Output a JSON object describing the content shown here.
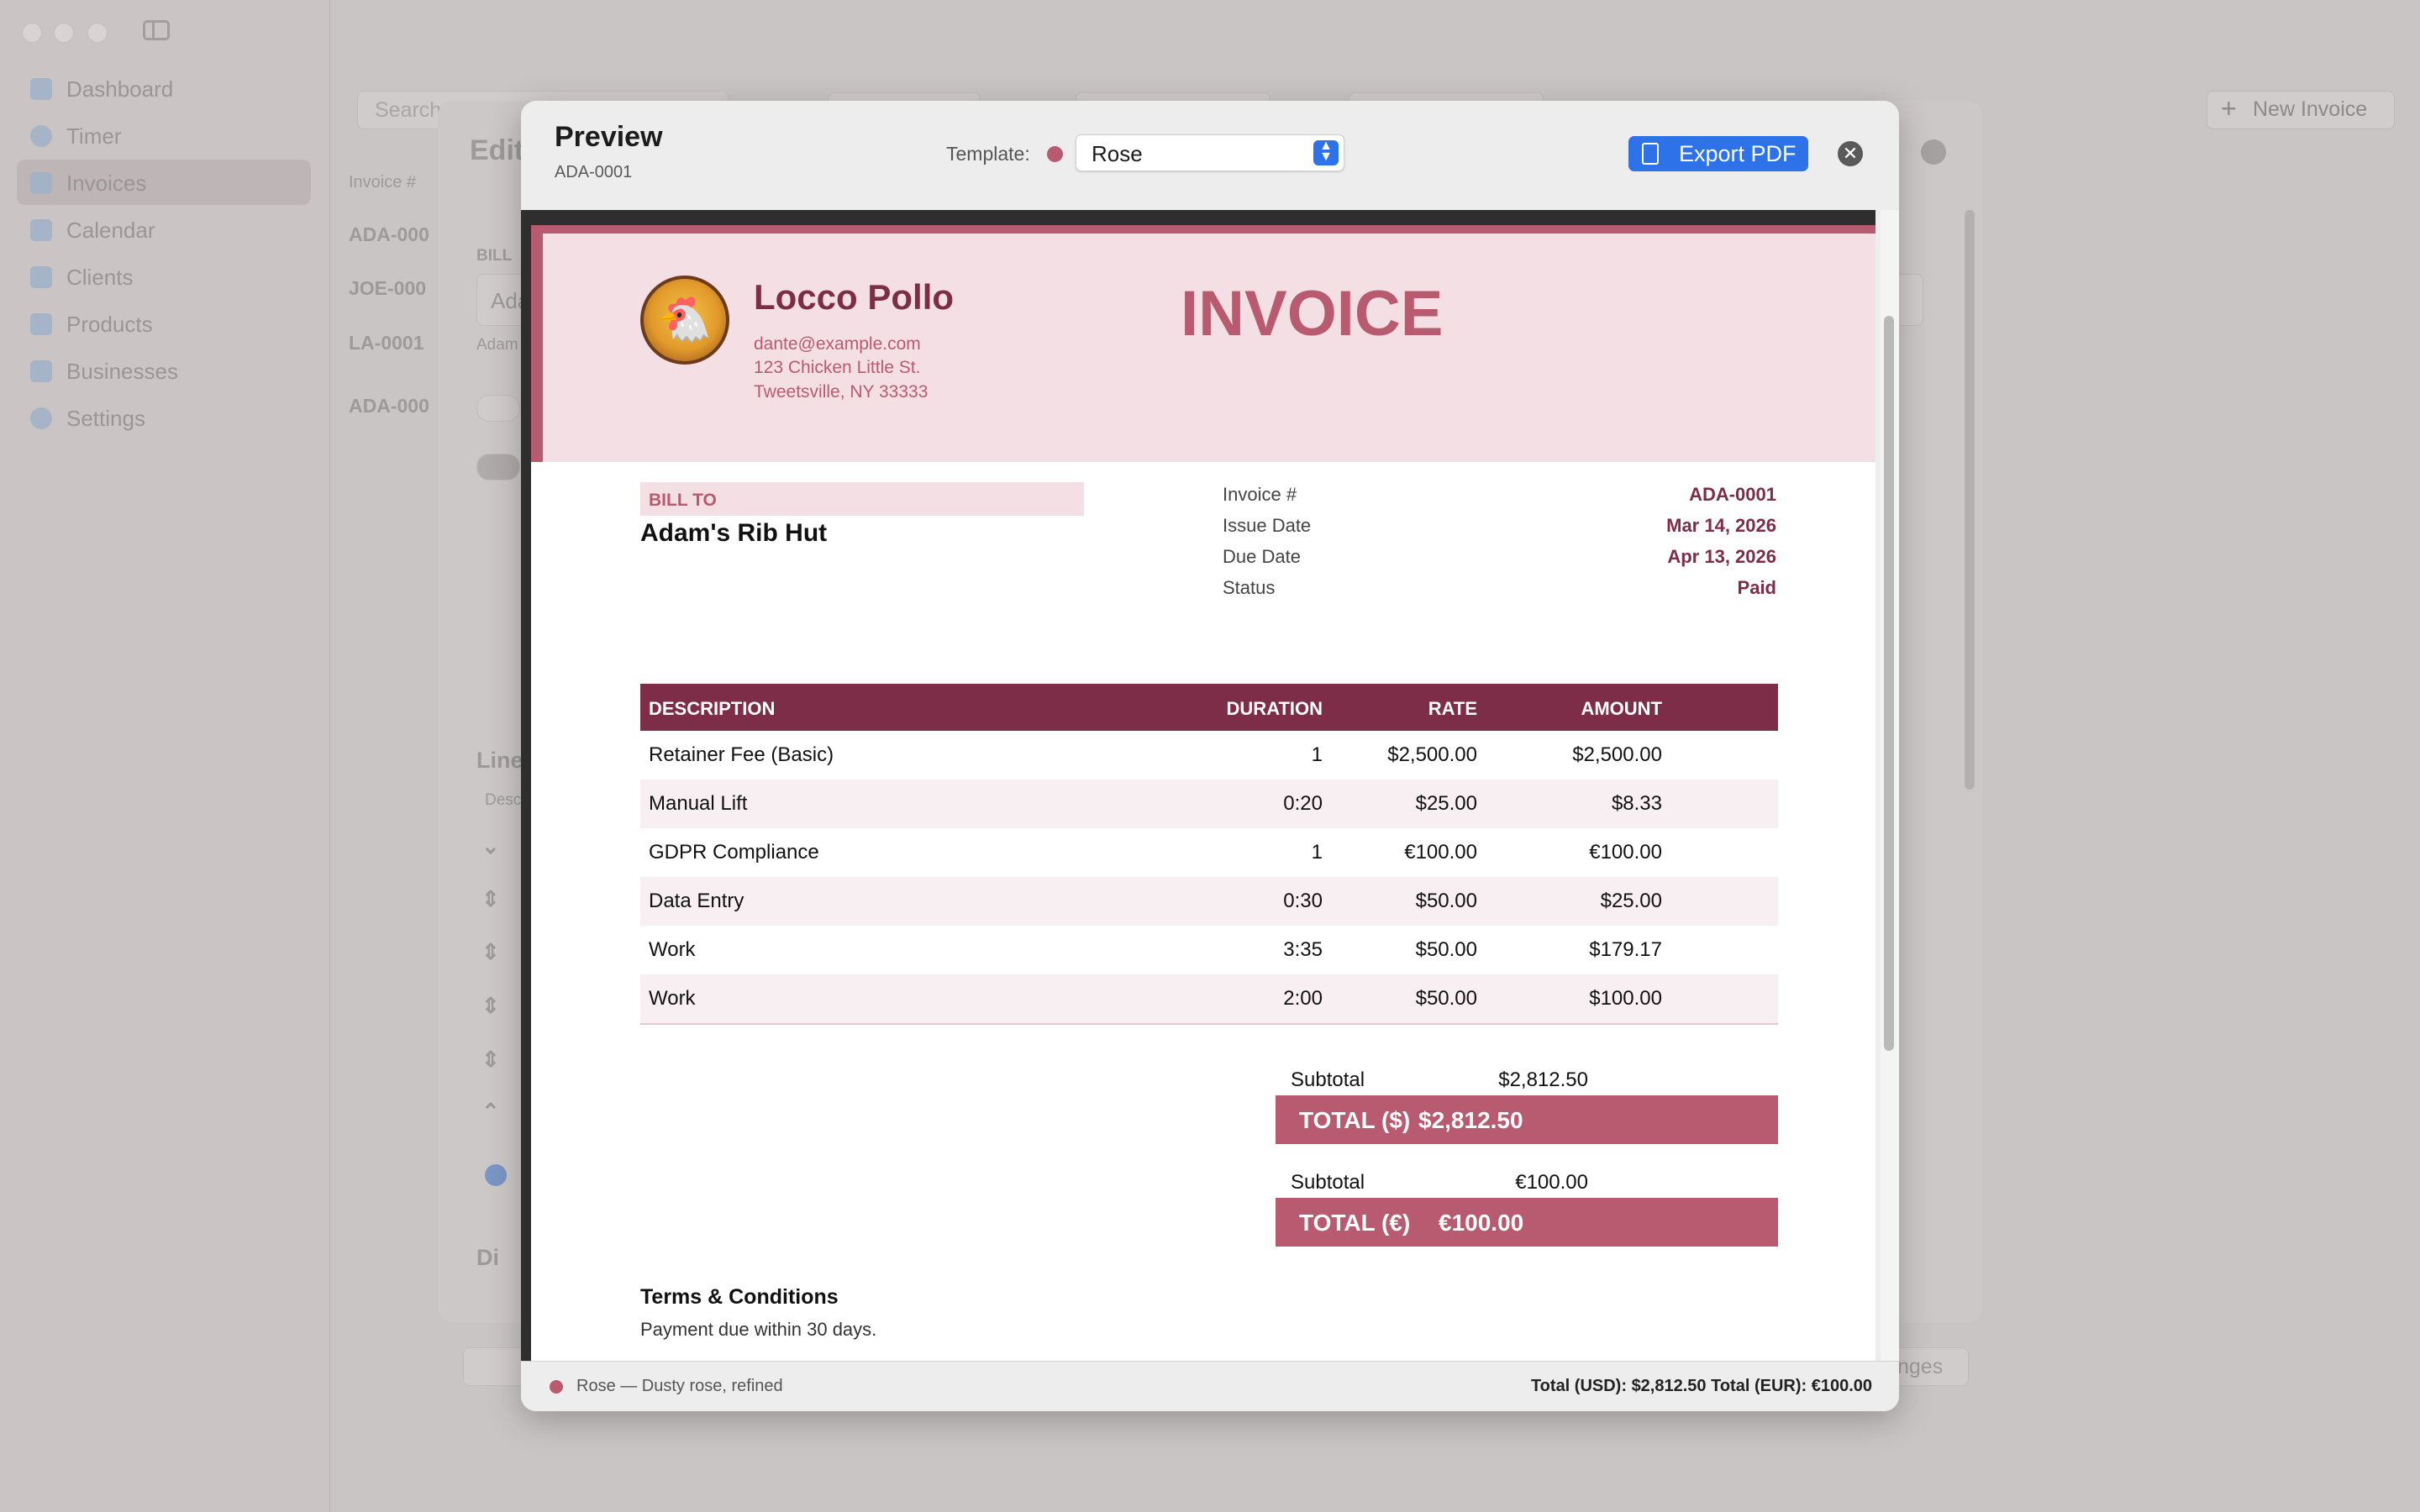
{
  "window": {
    "traffic_lights": [
      "close",
      "minimize",
      "zoom"
    ]
  },
  "sidebar": {
    "items": [
      {
        "label": "Dashboard",
        "icon": "chart-icon"
      },
      {
        "label": "Timer",
        "icon": "clock-icon"
      },
      {
        "label": "Invoices",
        "icon": "document-icon",
        "active": true
      },
      {
        "label": "Calendar",
        "icon": "calendar-icon"
      },
      {
        "label": "Clients",
        "icon": "people-icon"
      },
      {
        "label": "Products",
        "icon": "box-icon"
      },
      {
        "label": "Businesses",
        "icon": "building-icon"
      },
      {
        "label": "Settings",
        "icon": "gear-icon"
      }
    ]
  },
  "background": {
    "search_placeholder": "Search",
    "new_invoice_label": "New Invoice",
    "editor_title": "Edit",
    "column_invoice": "Invoice #",
    "invoice_ids": [
      "ADA-000",
      "JOE-000",
      "LA-0001",
      "ADA-000"
    ],
    "bill_to_label": "BILL",
    "client_field": "Ada",
    "client_hint": "Adam",
    "line_items_label": "Line",
    "desc_header": "Desc",
    "discount_label": "Di",
    "changes_label": "nges"
  },
  "preview": {
    "title": "Preview",
    "invoice_id": "ADA-0001",
    "template_label": "Template:",
    "template_value": "Rose",
    "template_color": "#b85a70",
    "export_label": "Export PDF",
    "footer_template": "Rose — Dusty rose, refined",
    "footer_totals": "Total (USD): $2,812.50   Total (EUR): €100.00"
  },
  "invoice": {
    "business": {
      "name": "Locco Pollo",
      "email": "dante@example.com",
      "address1": "123 Chicken Little St.",
      "address2": "Tweetsville, NY 33333"
    },
    "heading": "INVOICE",
    "bill_to_label": "BILL TO",
    "client": "Adam's Rib Hut",
    "meta": [
      {
        "label": "Invoice #",
        "value": "ADA-0001"
      },
      {
        "label": "Issue Date",
        "value": "Mar 14, 2026"
      },
      {
        "label": "Due Date",
        "value": "Apr 13, 2026"
      },
      {
        "label": "Status",
        "value": "Paid"
      }
    ],
    "columns": {
      "description": "DESCRIPTION",
      "duration": "DURATION",
      "rate": "RATE",
      "amount": "AMOUNT"
    },
    "lines": [
      {
        "description": "Retainer Fee (Basic)",
        "duration": "1",
        "rate": "$2,500.00",
        "amount": "$2,500.00"
      },
      {
        "description": "Manual Lift",
        "duration": "0:20",
        "rate": "$25.00",
        "amount": "$8.33"
      },
      {
        "description": "GDPR Compliance",
        "duration": "1",
        "rate": "€100.00",
        "amount": "€100.00"
      },
      {
        "description": "Data Entry",
        "duration": "0:30",
        "rate": "$50.00",
        "amount": "$25.00"
      },
      {
        "description": "Work",
        "duration": "3:35",
        "rate": "$50.00",
        "amount": "$179.17"
      },
      {
        "description": "Work",
        "duration": "2:00",
        "rate": "$50.00",
        "amount": "$100.00"
      }
    ],
    "totals": [
      {
        "subtotal_label": "Subtotal",
        "subtotal": "$2,812.50",
        "total_label": "TOTAL ($)",
        "total": "$2,812.50"
      },
      {
        "subtotal_label": "Subtotal",
        "subtotal": "€100.00",
        "total_label": "TOTAL (€)",
        "total": "€100.00"
      }
    ],
    "terms_heading": "Terms & Conditions",
    "terms_text": "Payment due within 30 days."
  }
}
